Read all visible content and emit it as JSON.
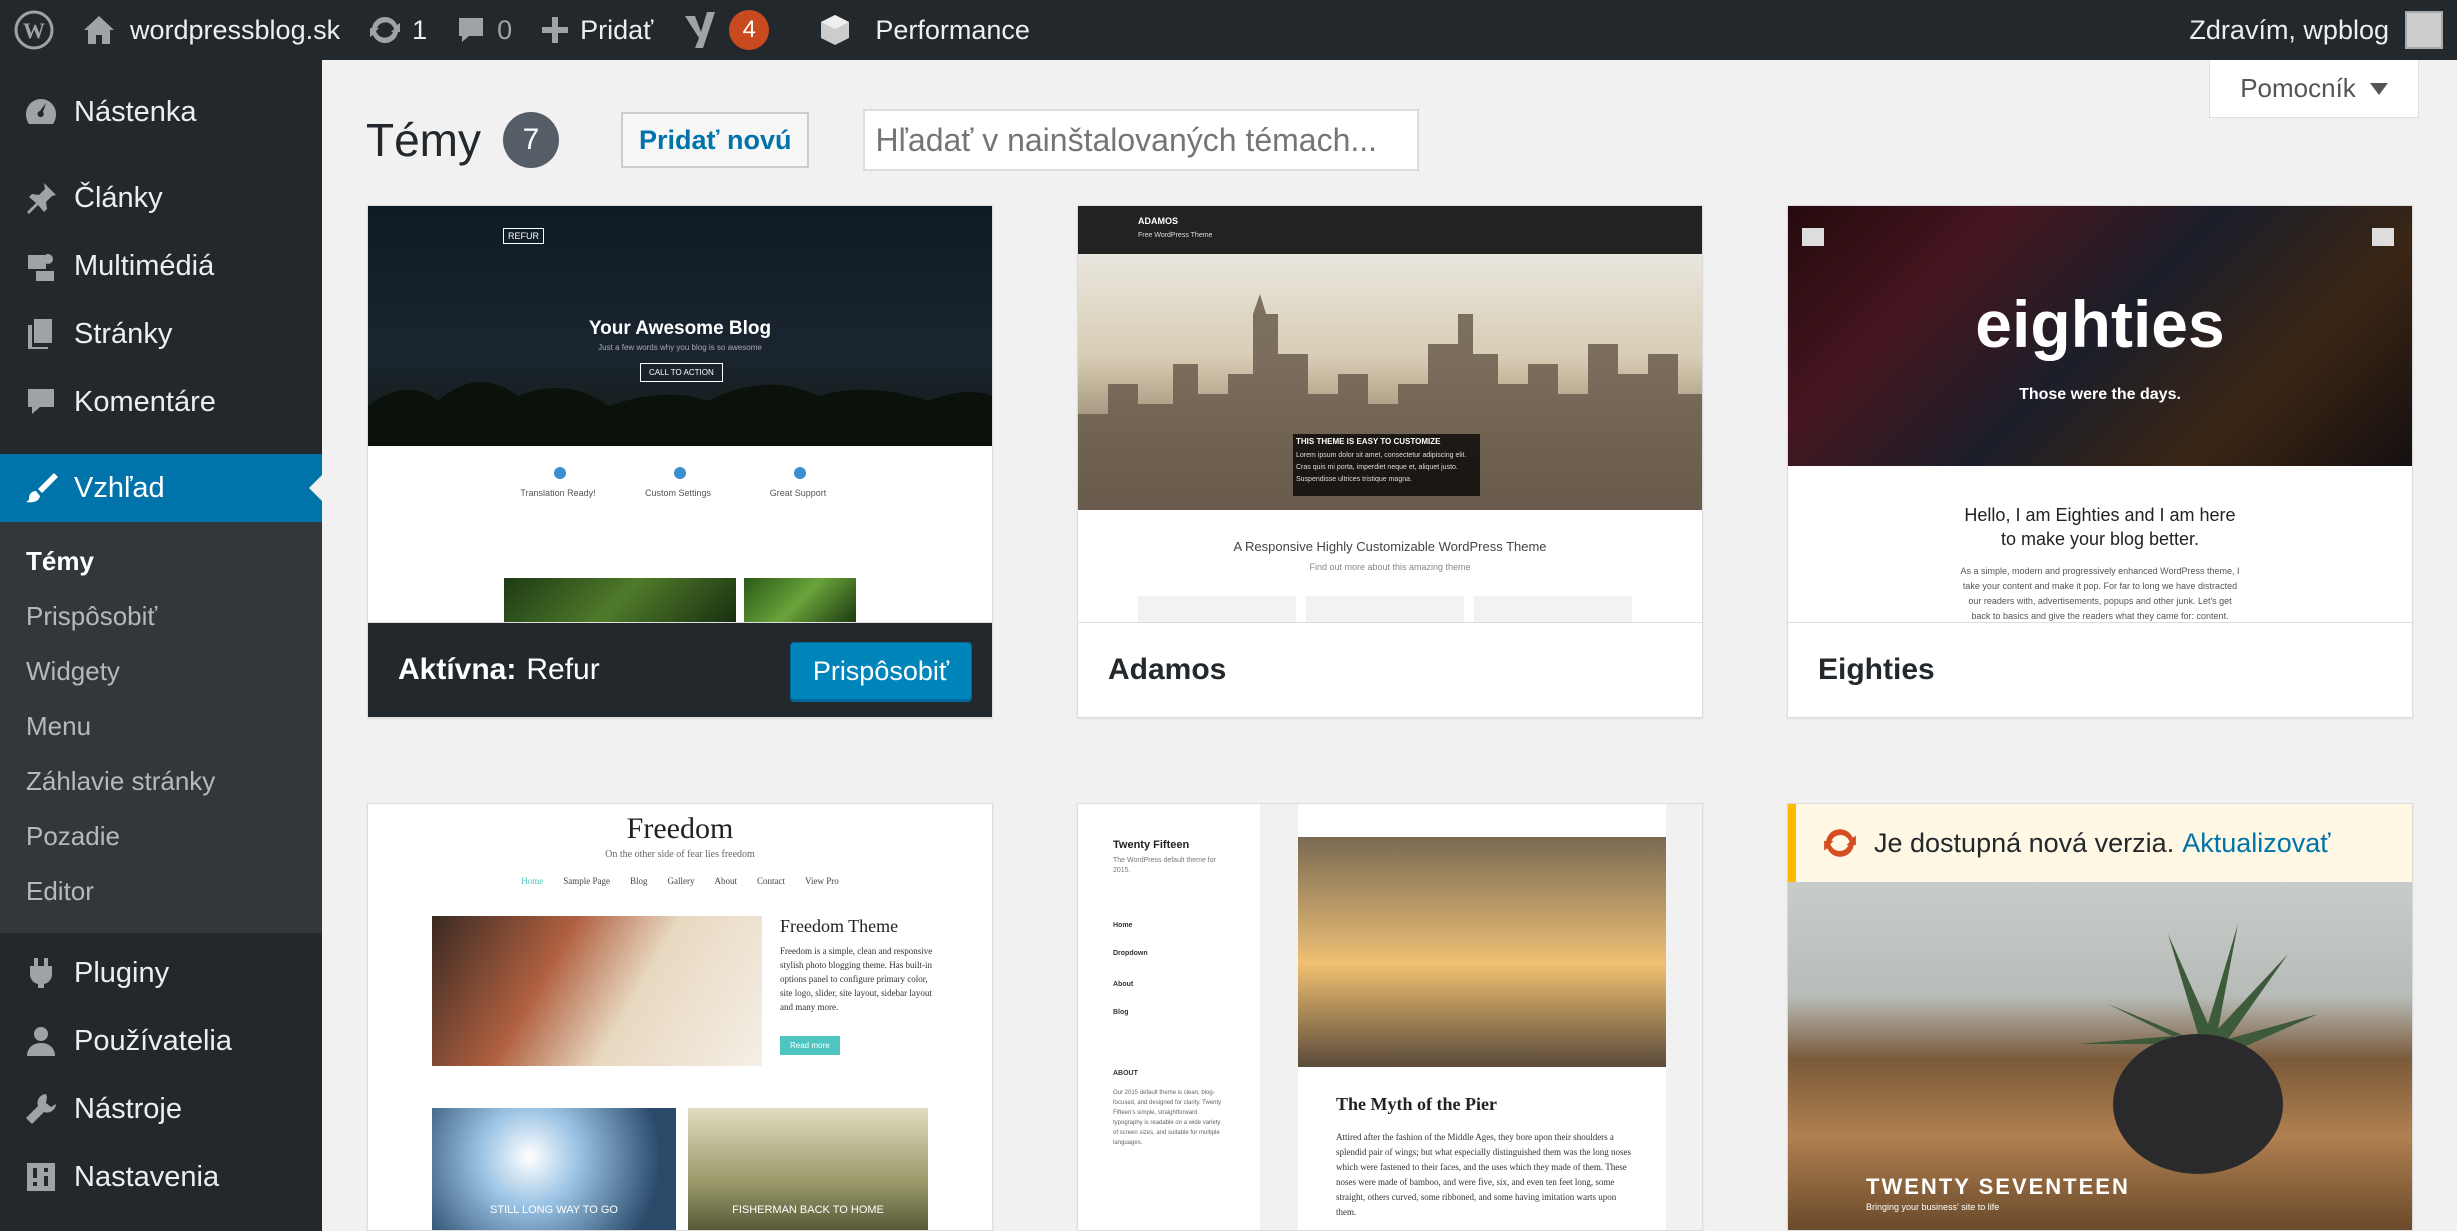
{
  "adminbar": {
    "site_name": "wordpressblog.sk",
    "updates_count": "1",
    "comments_count": "0",
    "new_label": "Pridať",
    "yoast_count": "4",
    "performance_label": "Performance",
    "greeting": "Zdravím, wpblog"
  },
  "sidebar": {
    "items": [
      {
        "label": "Nástenka",
        "icon": "dashboard-icon"
      },
      {
        "label": "Články",
        "icon": "pin-icon"
      },
      {
        "label": "Multimédiá",
        "icon": "media-icon"
      },
      {
        "label": "Stránky",
        "icon": "pages-icon"
      },
      {
        "label": "Komentáre",
        "icon": "comments-icon"
      },
      {
        "label": "Vzhľad",
        "icon": "appearance-icon"
      },
      {
        "label": "Pluginy",
        "icon": "plugins-icon"
      },
      {
        "label": "Používatelia",
        "icon": "users-icon"
      },
      {
        "label": "Nástroje",
        "icon": "tools-icon"
      },
      {
        "label": "Nastavenia",
        "icon": "settings-icon"
      }
    ],
    "submenu": [
      "Témy",
      "Prispôsobiť",
      "Widgety",
      "Menu",
      "Záhlavie stránky",
      "Pozadie",
      "Editor"
    ]
  },
  "main": {
    "help_label": "Pomocník",
    "title": "Témy",
    "theme_count": "7",
    "add_new_label": "Pridať novú",
    "search_placeholder": "Hľadať v nainštalovaných témach..."
  },
  "themes": [
    {
      "name": "Refur",
      "active_prefix": "Aktívna:",
      "customize_label": "Prispôsobiť",
      "preview": {
        "headline": "Your Awesome Blog",
        "subline": "Just a few words why you blog is so awesome",
        "cta": "CALL TO ACTION",
        "logo": "REFUR",
        "features": [
          "Translation Ready!",
          "Custom Settings",
          "Great Support"
        ]
      }
    },
    {
      "name": "Adamos",
      "preview": {
        "logo": "ADAMOS",
        "logo_sub": "Free WordPress Theme",
        "overlay_title": "THIS THEME IS EASY TO CUSTOMIZE",
        "overlay_text": "Lorem ipsum dolor sit amet, consectetur adipiscing elit. Cras quis mi porta, imperdiet neque et, aliquet justo. Suspendisse ultrices tristique magna.",
        "tagline": "A Responsive Highly Customizable WordPress Theme",
        "tagline_sub": "Find out more about this amazing theme"
      }
    },
    {
      "name": "Eighties",
      "preview": {
        "logo": "eighties",
        "slogan": "Those were the days.",
        "hello": "Hello, I am Eighties and I am here to make your blog better.",
        "body": "As a simple, modern and progressively enhanced WordPress theme, I take your content and make it pop. For far to long we have distracted our readers with, advertisements, popups and other junk. Let's get back to basics and give the readers what they came for: content."
      }
    },
    {
      "name": "Freedom",
      "preview": {
        "title": "Freedom",
        "subtitle": "On the other side of fear lies freedom",
        "nav": [
          "Home",
          "Sample Page",
          "Blog",
          "Gallery",
          "About",
          "Contact",
          "View Pro"
        ],
        "heading": "Freedom Theme",
        "text": "Freedom is a simple, clean and responsive stylish photo blogging theme. Has built-in options panel to configure primary color, site logo, slider, site layout, sidebar layout and many more.",
        "button": "Read more",
        "thumb1": "STILL LONG WAY TO GO",
        "thumb2": "FISHERMAN BACK TO HOME"
      }
    },
    {
      "name": "Twenty Fifteen",
      "preview": {
        "site": "Twenty Fifteen",
        "desc": "The WordPress default theme for 2015.",
        "post_title": "The Myth of the Pier",
        "post_text": "Attired after the fashion of the Middle Ages, they bore upon their shoulders a splendid pair of wings; but what especially distinguished them was the long noses which were fastened to their faces, and the uses which they made of them. These noses were made of bamboo, and were five, six, and even ten feet long, some straight, others curved, some ribboned, and some having imitation warts upon them.",
        "menu": [
          "Home",
          "Dropdown",
          "About",
          "Blog"
        ],
        "about": "ABOUT",
        "about_text": "Our 2015 default theme is clean, blog-focused, and designed for clarity. Twenty Fifteen's simple, straightforward typography is readable on a wide variety of screen sizes, and suitable for multiple languages."
      }
    },
    {
      "name": "Twenty Seventeen",
      "update_text": "Je dostupná nová verzia.",
      "update_link": "Aktualizovať",
      "preview": {
        "title": "TWENTY SEVENTEEN",
        "tagline": "Bringing your business' site to life"
      }
    }
  ],
  "colors": {
    "adminbar": "#23282d",
    "accent": "#0073aa",
    "button": "#0085ba",
    "badge": "#ca4a1f"
  }
}
